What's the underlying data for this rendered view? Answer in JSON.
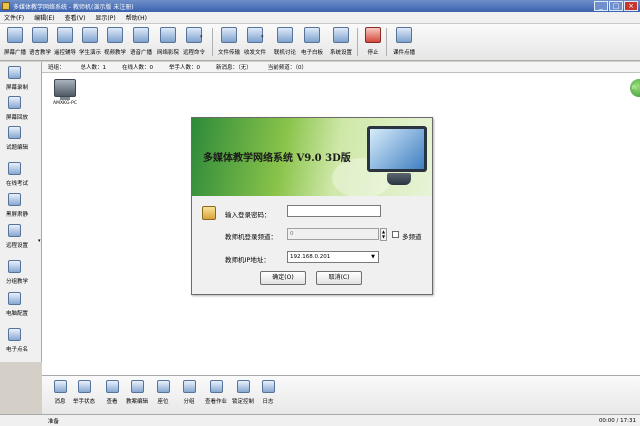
{
  "window": {
    "title": "多媒体教学网络系统 - 教师机(演示版 未注册)"
  },
  "menu": [
    "文件(F)",
    "编辑(E)",
    "查看(V)",
    "显示(P)",
    "帮助(H)"
  ],
  "toolbar": [
    {
      "label": "屏幕广播",
      "icon": "screen-broadcast-icon"
    },
    {
      "label": "语言教学",
      "icon": "audio-teach-icon"
    },
    {
      "label": "遥控辅导",
      "icon": "remote-control-icon"
    },
    {
      "label": "学生演示",
      "icon": "student-demo-icon"
    },
    {
      "label": "视频教学",
      "icon": "video-teach-icon"
    },
    {
      "label": "语音广播",
      "icon": "voice-broadcast-icon"
    },
    {
      "label": "网络影院",
      "icon": "network-cinema-icon"
    },
    {
      "label": "远程命令",
      "icon": "remote-command-icon"
    },
    {
      "label": "文件传输",
      "icon": "file-transfer-icon"
    },
    {
      "label": "收发文件",
      "icon": "send-receive-icon"
    },
    {
      "label": "联机讨论",
      "icon": "online-discuss-icon"
    },
    {
      "label": "电子白板",
      "icon": "whiteboard-icon"
    },
    {
      "label": "系统设置",
      "icon": "system-settings-icon"
    },
    {
      "label": "停止",
      "icon": "stop-icon"
    },
    {
      "label": "课件点播",
      "icon": "courseware-icon"
    }
  ],
  "sidebar": [
    {
      "label": "屏幕录制",
      "icon": "screen-record-icon"
    },
    {
      "label": "屏幕回放",
      "icon": "screen-replay-icon"
    },
    {
      "label": "试题编辑",
      "icon": "exam-edit-icon"
    },
    {
      "label": "在线考试",
      "icon": "online-exam-icon"
    },
    {
      "label": "黑屏肃静",
      "icon": "black-screen-icon"
    },
    {
      "label": "远程设置",
      "icon": "remote-settings-icon"
    },
    {
      "label": "分组教学",
      "icon": "group-teach-icon"
    },
    {
      "label": "电脑配置",
      "icon": "pc-config-icon"
    },
    {
      "label": "电子点名",
      "icon": "roll-call-icon"
    }
  ],
  "status_line": {
    "group": "班组：",
    "total": "总人数：1",
    "online": "在线人数：0",
    "hands": "举手人数：0",
    "newmsg": "新消息：（无）",
    "channel": "当前频道：（0）"
  },
  "workspace": {
    "computer_name": "AMXKG-PC"
  },
  "dialog": {
    "banner_title": "多媒体教学网络系统 V9.0 3D版",
    "password_label": "输入登录密码：",
    "password_value": "",
    "channel_label": "教师机登录频道：",
    "channel_value": "0",
    "multi_channel_label": "多频道",
    "ip_label": "教师机IP地址：",
    "ip_value": "192.168.0.201",
    "ok_label": "确定(O)",
    "cancel_label": "取消(C)"
  },
  "bottombar": [
    {
      "label": "消息",
      "icon": "message-icon"
    },
    {
      "label": "举手状态",
      "icon": "hand-status-icon"
    },
    {
      "label": "查看",
      "icon": "view-icon"
    },
    {
      "label": "教案编辑",
      "icon": "lesson-edit-icon"
    },
    {
      "label": "座位",
      "icon": "seat-icon"
    },
    {
      "label": "分组",
      "icon": "group-icon"
    },
    {
      "label": "查看作业",
      "icon": "homework-icon"
    },
    {
      "label": "锁定控制",
      "icon": "lock-control-icon"
    },
    {
      "label": "日志",
      "icon": "log-icon"
    }
  ],
  "statusbar": {
    "left": "准备",
    "right": "00:00 / 17:31"
  },
  "colors": {
    "titlebar": "#3a62b0",
    "banner_green": "#2d8a3a"
  }
}
